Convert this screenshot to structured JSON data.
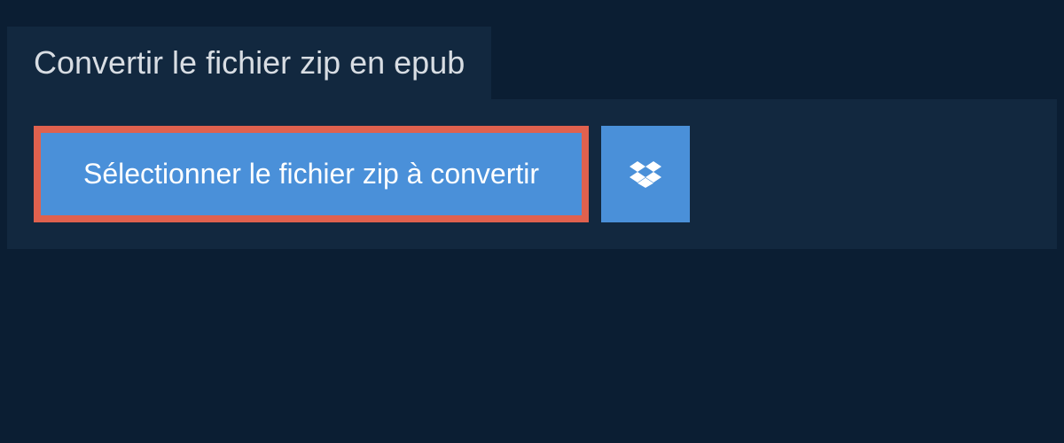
{
  "title": "Convertir le fichier zip en epub",
  "buttons": {
    "select_file_label": "Sélectionner le fichier zip à convertir",
    "dropbox_icon": "dropbox-icon"
  }
}
